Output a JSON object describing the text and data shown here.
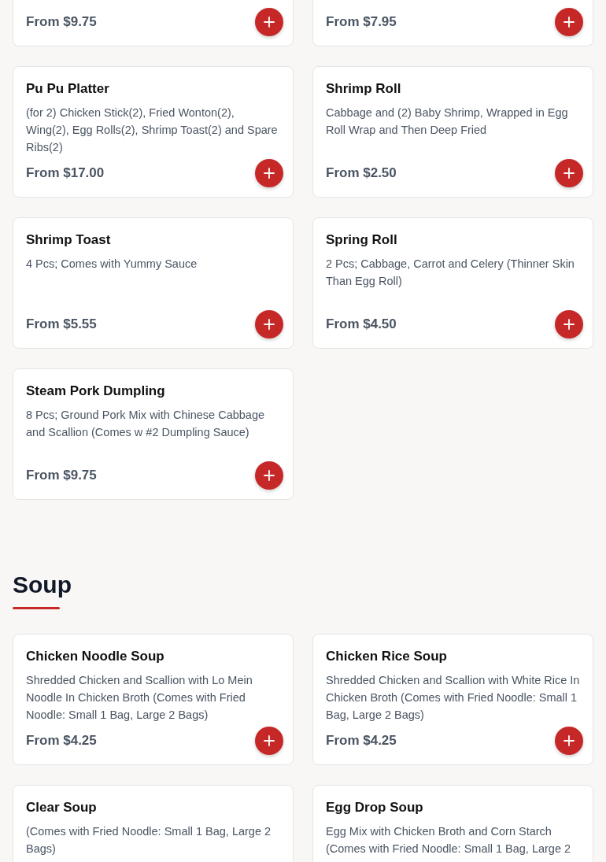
{
  "sections": [
    {
      "items": [
        {
          "kind": "partial",
          "price": "From $9.75"
        },
        {
          "kind": "partial",
          "price": "From $7.95"
        },
        {
          "kind": "full",
          "name": "Pu Pu Platter",
          "description": "(for 2) Chicken Stick(2), Fried Wonton(2), Wing(2), Egg Rolls(2), Shrimp Toast(2) and Spare Ribs(2)",
          "price": "From $17.00"
        },
        {
          "kind": "full",
          "name": "Shrimp Roll",
          "description": "Cabbage and (2) Baby Shrimp, Wrapped in Egg Roll Wrap and Then Deep Fried",
          "price": "From $2.50"
        },
        {
          "kind": "full",
          "name": "Shrimp Toast",
          "description": "4 Pcs; Comes with Yummy Sauce",
          "price": "From $5.55"
        },
        {
          "kind": "full",
          "name": "Spring Roll",
          "description": "2 Pcs; Cabbage, Carrot and Celery (Thinner Skin Than Egg Roll)",
          "price": "From $4.50"
        },
        {
          "kind": "full",
          "name": "Steam Pork Dumpling",
          "description": "8 Pcs; Ground Pork Mix with Chinese Cabbage and Scallion (Comes w #2 Dumpling Sauce)",
          "price": "From $9.75"
        }
      ]
    },
    {
      "title": "Soup",
      "items": [
        {
          "kind": "full",
          "name": "Chicken Noodle Soup",
          "description": "Shredded Chicken and Scallion with Lo Mein Noodle In Chicken Broth (Comes with Fried Noodle: Small 1 Bag, Large 2 Bags)",
          "price": "From $4.25"
        },
        {
          "kind": "full",
          "name": "Chicken Rice Soup",
          "description": "Shredded Chicken and Scallion with White Rice In Chicken Broth (Comes with Fried Noodle: Small 1 Bag, Large 2 Bags)",
          "price": "From $4.25"
        },
        {
          "kind": "full",
          "name": "Clear Soup",
          "description": "(Comes with Fried Noodle: Small 1 Bag, Large 2 Bags)"
        },
        {
          "kind": "full",
          "name": "Egg Drop Soup",
          "description": "Egg Mix with Chicken Broth and Corn Starch (Comes with Fried Noodle: Small 1 Bag, Large 2"
        }
      ]
    }
  ]
}
